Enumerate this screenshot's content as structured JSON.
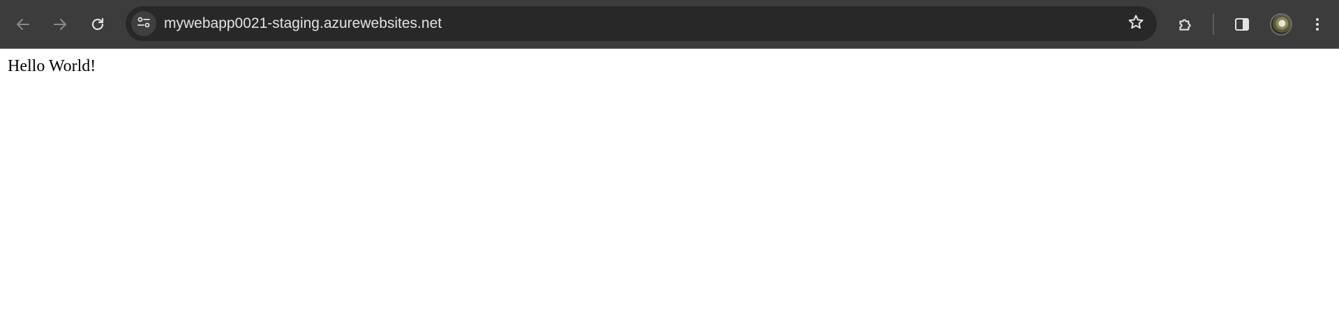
{
  "browser": {
    "url": "mywebapp0021-staging.azurewebsites.net",
    "icons": {
      "back": "back-arrow-icon",
      "forward": "forward-arrow-icon",
      "reload": "reload-icon",
      "site_info": "tune-icon",
      "bookmark": "star-icon",
      "extensions": "puzzle-icon",
      "side_panel": "side-panel-icon",
      "profile": "avatar",
      "menu": "kebab-menu-icon"
    },
    "colors": {
      "toolbar": "#3c3c3c",
      "omnibox": "#282828",
      "icon": "#e3e3e3",
      "disabled_icon": "#8a8a8a"
    }
  },
  "page": {
    "body_text": "Hello World!",
    "background": "#ffffff"
  }
}
